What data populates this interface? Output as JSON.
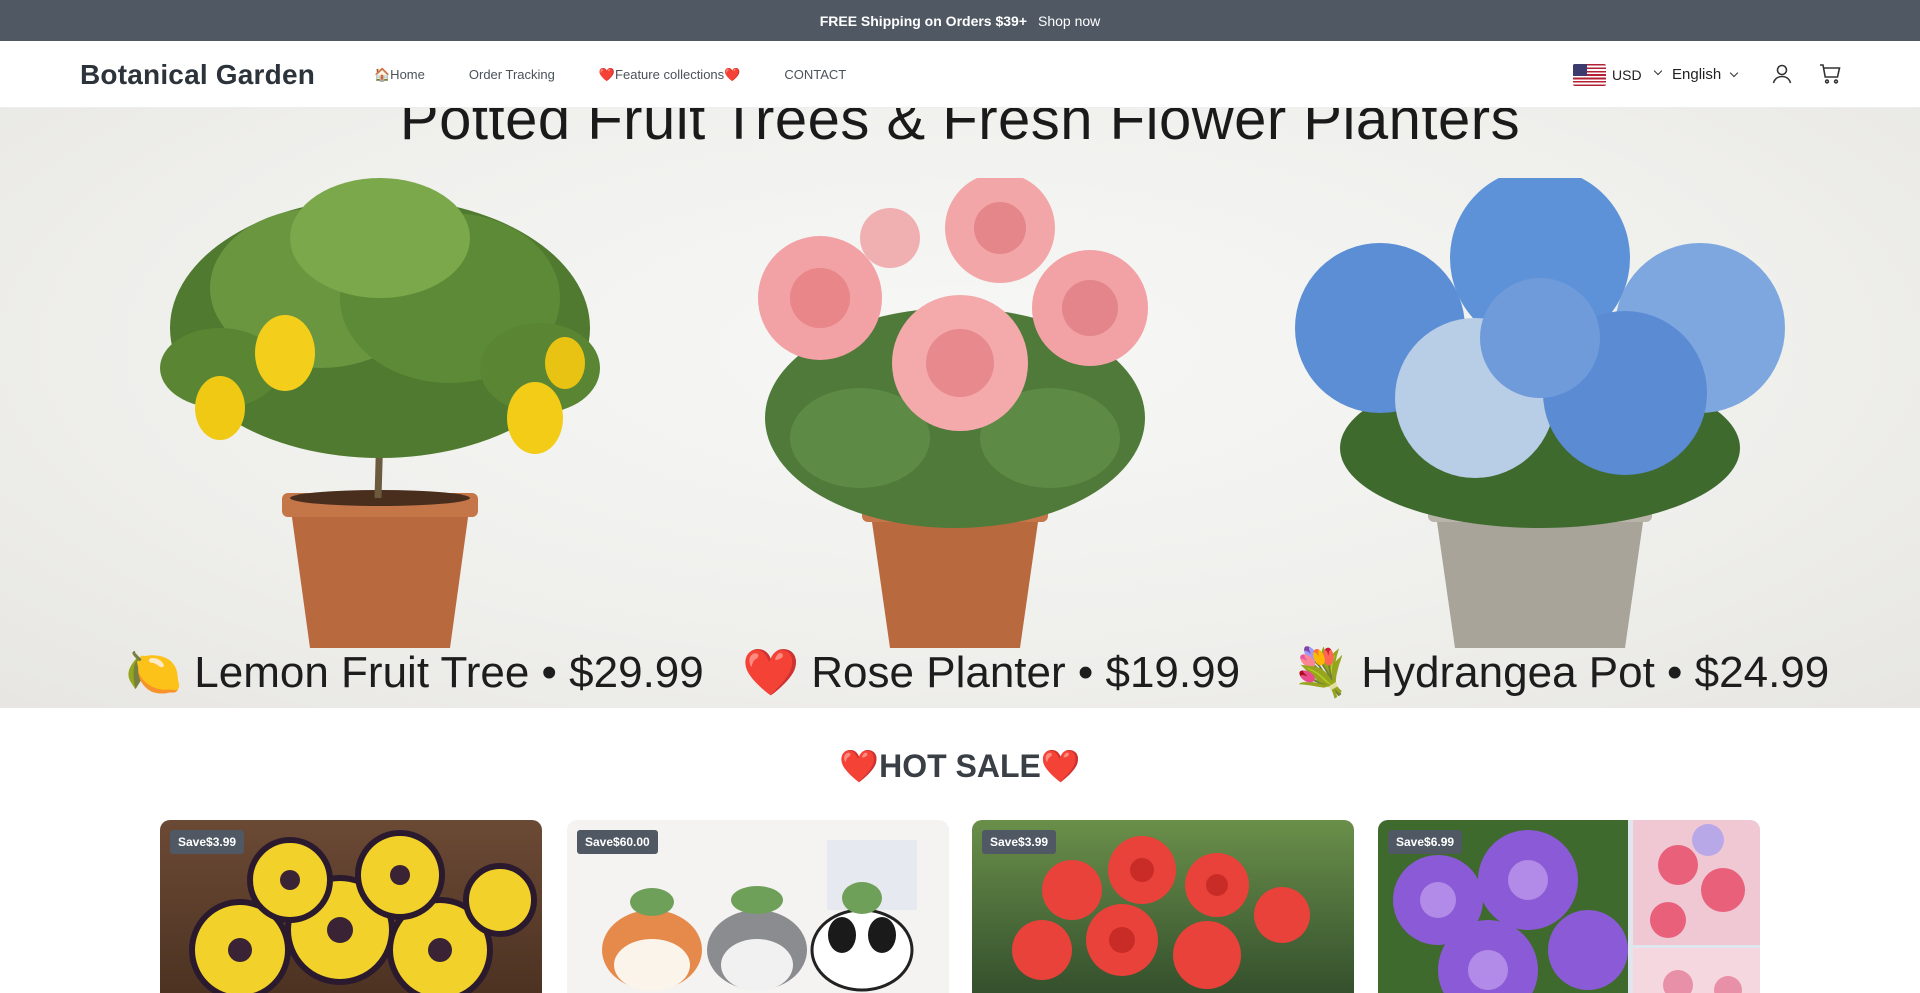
{
  "announcement": {
    "text": "FREE Shipping on Orders $39+",
    "link": "Shop now"
  },
  "header": {
    "logo": "Botanical Garden",
    "nav": [
      {
        "label": "🏠Home"
      },
      {
        "label": "Order Tracking"
      },
      {
        "label": "❤️Feature collections❤️"
      },
      {
        "label": "CONTACT"
      }
    ],
    "currency": "USD",
    "language": "English"
  },
  "hero": {
    "title": "Potted Fruit Trees & Fresh Flower Planters",
    "captions": [
      {
        "emoji": "🍋",
        "text": "Lemon Fruit Tree • $29.99"
      },
      {
        "emoji": "❤️",
        "text": "Rose Planter • $19.99"
      },
      {
        "emoji": "💐",
        "text": "Hydrangea Pot • $24.99"
      }
    ]
  },
  "hot_sale": {
    "title": "❤️HOT SALE❤️",
    "products": [
      {
        "badge": "Save$3.99"
      },
      {
        "badge": "Save$60.00"
      },
      {
        "badge": "Save$3.99"
      },
      {
        "badge": "Save$6.99"
      }
    ]
  },
  "colors": {
    "announcement_bg": "#4f5863",
    "badge_bg": "#4f5863",
    "heart": "#e53935"
  }
}
